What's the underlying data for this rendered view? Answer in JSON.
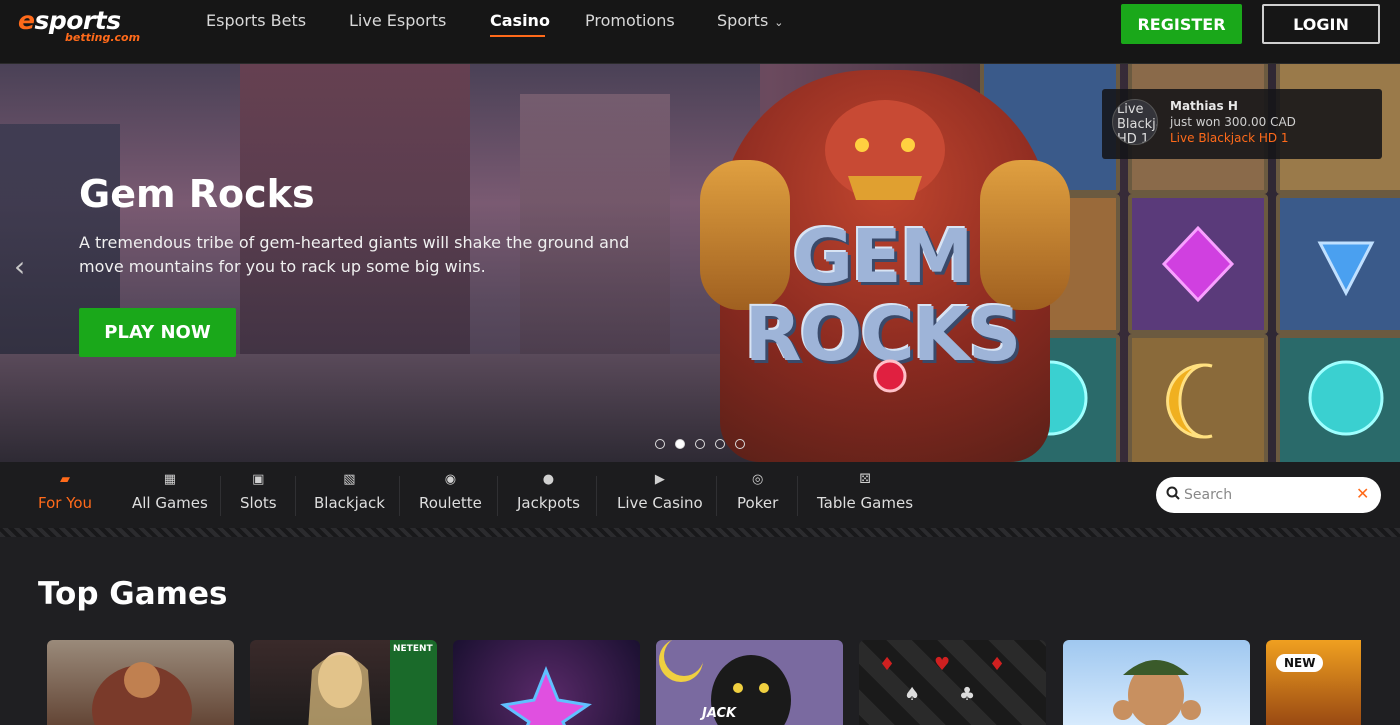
{
  "header": {
    "logo": {
      "main_e": "e",
      "main_rest": "sports",
      "sub": "betting.com"
    },
    "nav": [
      {
        "label": "Esports Bets",
        "active": false
      },
      {
        "label": "Live Esports",
        "active": false
      },
      {
        "label": "Casino",
        "active": true
      },
      {
        "label": "Promotions",
        "active": false
      },
      {
        "label": "Sports",
        "active": false,
        "has_dropdown": true
      }
    ],
    "register_label": "REGISTER",
    "login_label": "LOGIN"
  },
  "hero": {
    "title": "Gem Rocks",
    "description": "A tremendous tribe of gem-hearted giants will shake the ground and move mountains for you to rack up some big wins.",
    "cta_label": "PLAY NOW",
    "art_title": "GEM ROCKS",
    "slide_count": 5,
    "active_slide": 2,
    "prev_arrow": "‹"
  },
  "win_toast": {
    "avatar_alt": "Live Blackjack HD 1",
    "name": "Mathias H",
    "message": "just won 300.00 CAD",
    "game": "Live Blackjack HD 1"
  },
  "categories": [
    {
      "label": "For You",
      "icon": "cards-stack-icon",
      "active": true
    },
    {
      "label": "All Games",
      "icon": "grid-icon",
      "active": false
    },
    {
      "label": "Slots",
      "icon": "slot-machine-icon",
      "active": false
    },
    {
      "label": "Blackjack",
      "icon": "playing-card-icon",
      "active": false
    },
    {
      "label": "Roulette",
      "icon": "roulette-icon",
      "active": false
    },
    {
      "label": "Jackpots",
      "icon": "money-bag-icon",
      "active": false
    },
    {
      "label": "Live Casino",
      "icon": "video-camera-icon",
      "active": false
    },
    {
      "label": "Poker",
      "icon": "poker-chip-icon",
      "active": false
    },
    {
      "label": "Table Games",
      "icon": "dice-icon",
      "active": false
    }
  ],
  "search": {
    "placeholder": "Search",
    "clear": "✕"
  },
  "top_games": {
    "title": "Top Games",
    "games": [
      {
        "name": "viking-slot-game",
        "badge": ""
      },
      {
        "name": "netent-live-dealer-game",
        "badge": "",
        "provider": "NETENT"
      },
      {
        "name": "starburst-game",
        "badge": ""
      },
      {
        "name": "jack-game",
        "badge": "",
        "label": "JACK"
      },
      {
        "name": "blackjack-game",
        "badge": ""
      },
      {
        "name": "gonzo-game",
        "badge": ""
      },
      {
        "name": "new-game",
        "badge": "NEW"
      }
    ]
  },
  "colors": {
    "accent": "#ff6a1a",
    "green": "#1aa81a",
    "header_bg": "#161616",
    "page_bg": "#1f1f22"
  }
}
